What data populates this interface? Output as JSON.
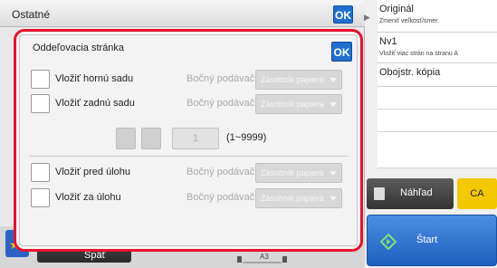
{
  "header": {
    "title": "Ostatné",
    "ok_label": "OK"
  },
  "dialog": {
    "title": "Oddeľovacia stránka",
    "ok_label": "OK",
    "rows": [
      {
        "label": "Vložiť hornú sadu",
        "tray_label": "Bočný podávač",
        "tray_value": "Zásobník papiera"
      },
      {
        "label": "Vložiť zadnú sadu",
        "tray_label": "Bočný podávač",
        "tray_value": "Zásobník papiera"
      },
      {
        "label": "Vložiť pred úlohu",
        "tray_label": "Bočný podávač",
        "tray_value": "Zásobník papiera"
      },
      {
        "label": "Vložiť za úlohu",
        "tray_label": "Bočný podávač",
        "tray_value": "Zásobník papiera"
      }
    ],
    "count": {
      "value": "1",
      "range": "(1~9999)"
    }
  },
  "bottom": {
    "back_label": "Späť",
    "paper_size": "A3"
  },
  "right_panel": {
    "items": [
      {
        "title": "Originál",
        "subtitle": "Zmeniť veľkosť/smer."
      },
      {
        "title": "Nv1",
        "subtitle": "Vložiť viac strán na stranu A"
      },
      {
        "title": "Obojstr. kópia",
        "subtitle": ""
      }
    ],
    "preview_label": "Náhľad",
    "ca_label": "CA",
    "start_label": "Štart"
  },
  "colors": {
    "accent_blue": "#1f6fcf",
    "highlight_red": "#e8112d",
    "ca_yellow": "#f4c800"
  },
  "icons": [
    "star-icon",
    "chevron-down-icon",
    "preview-icon",
    "start-icon"
  ]
}
